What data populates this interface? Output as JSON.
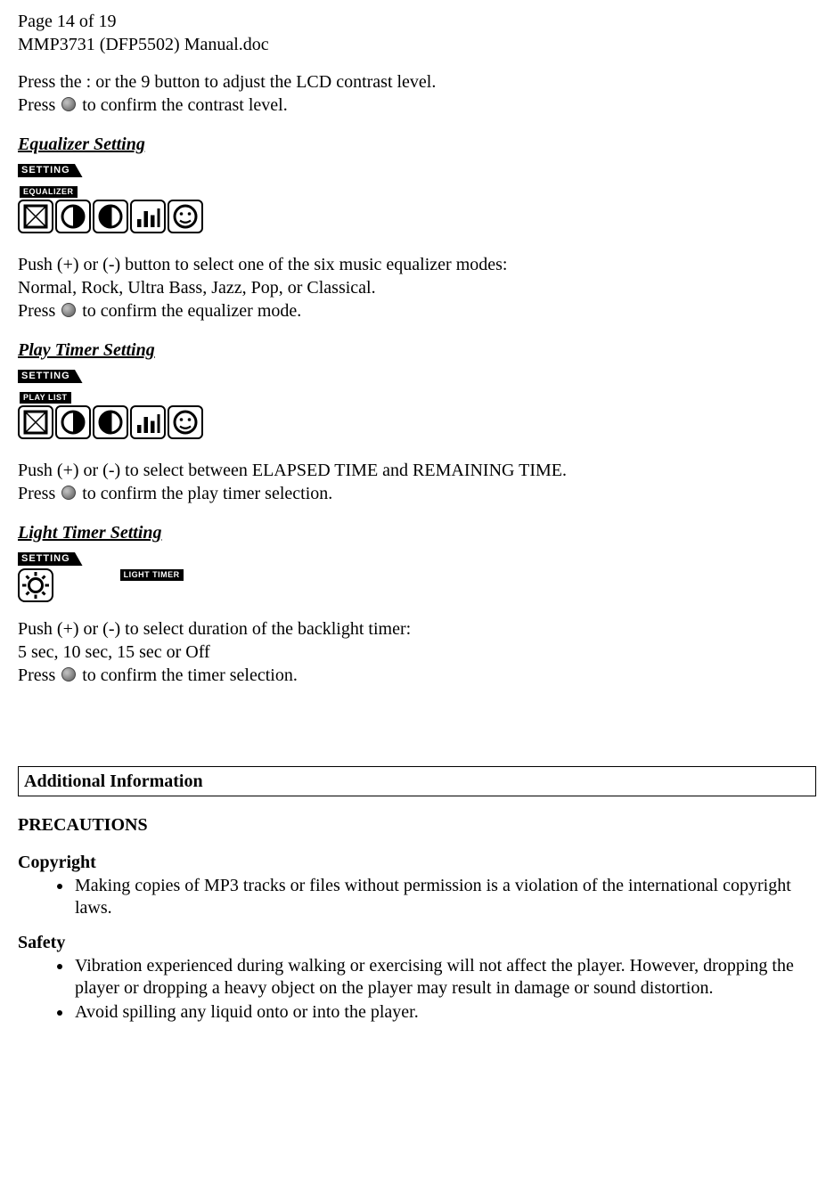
{
  "header": {
    "pageline": "Page 14 of 19",
    "docname": "MMP3731 (DFP5502) Manual.doc"
  },
  "intro": {
    "line1_a": "Press the  :   or the ",
    "line1_b": "9",
    "line1_c": "  button to adjust the LCD contrast level.",
    "line2_a": "Press ",
    "line2_b": " to confirm the contrast level."
  },
  "sections": {
    "equalizer": {
      "title": "Equalizer Setting",
      "lcd_tab": "SETTING",
      "lcd_label": "EQUALIZER",
      "p1": "Push (+) or (-) button to select one of the six music equalizer modes:",
      "p2": "Normal, Rock, Ultra Bass, Jazz, Pop, or Classical.",
      "p3_a": "Press ",
      "p3_b": " to confirm the equalizer mode."
    },
    "playtimer": {
      "title": "Play Timer Setting",
      "lcd_tab": "SETTING",
      "lcd_label": "PLAY LIST",
      "p1": "Push (+) or (-) to select between ELAPSED TIME and REMAINING TIME.",
      "p2_a": "Press ",
      "p2_b": " to confirm the play timer selection."
    },
    "lighttimer": {
      "title": "Light Timer Setting",
      "lcd_tab": "SETTING",
      "lcd_label": "LIGHT TIMER",
      "p1": "Push (+) or (-) to select duration of the backlight timer:",
      "p2": "5 sec, 10 sec, 15 sec or Off",
      "p3_a": "Press ",
      "p3_b": " to confirm the timer selection."
    }
  },
  "additional": {
    "boxtitle": "Additional Information",
    "precautions": "PRECAUTIONS",
    "copyright": {
      "title": "Copyright",
      "b1": "Making copies of MP3 tracks or files without permission is a violation of the international copyright laws."
    },
    "safety": {
      "title": "Safety",
      "b1": "Vibration experienced during walking or exercising will not affect the player. However, dropping the player or dropping a heavy object on the player may result in damage or sound distortion.",
      "b2": "Avoid spilling any liquid onto or into the player."
    }
  }
}
